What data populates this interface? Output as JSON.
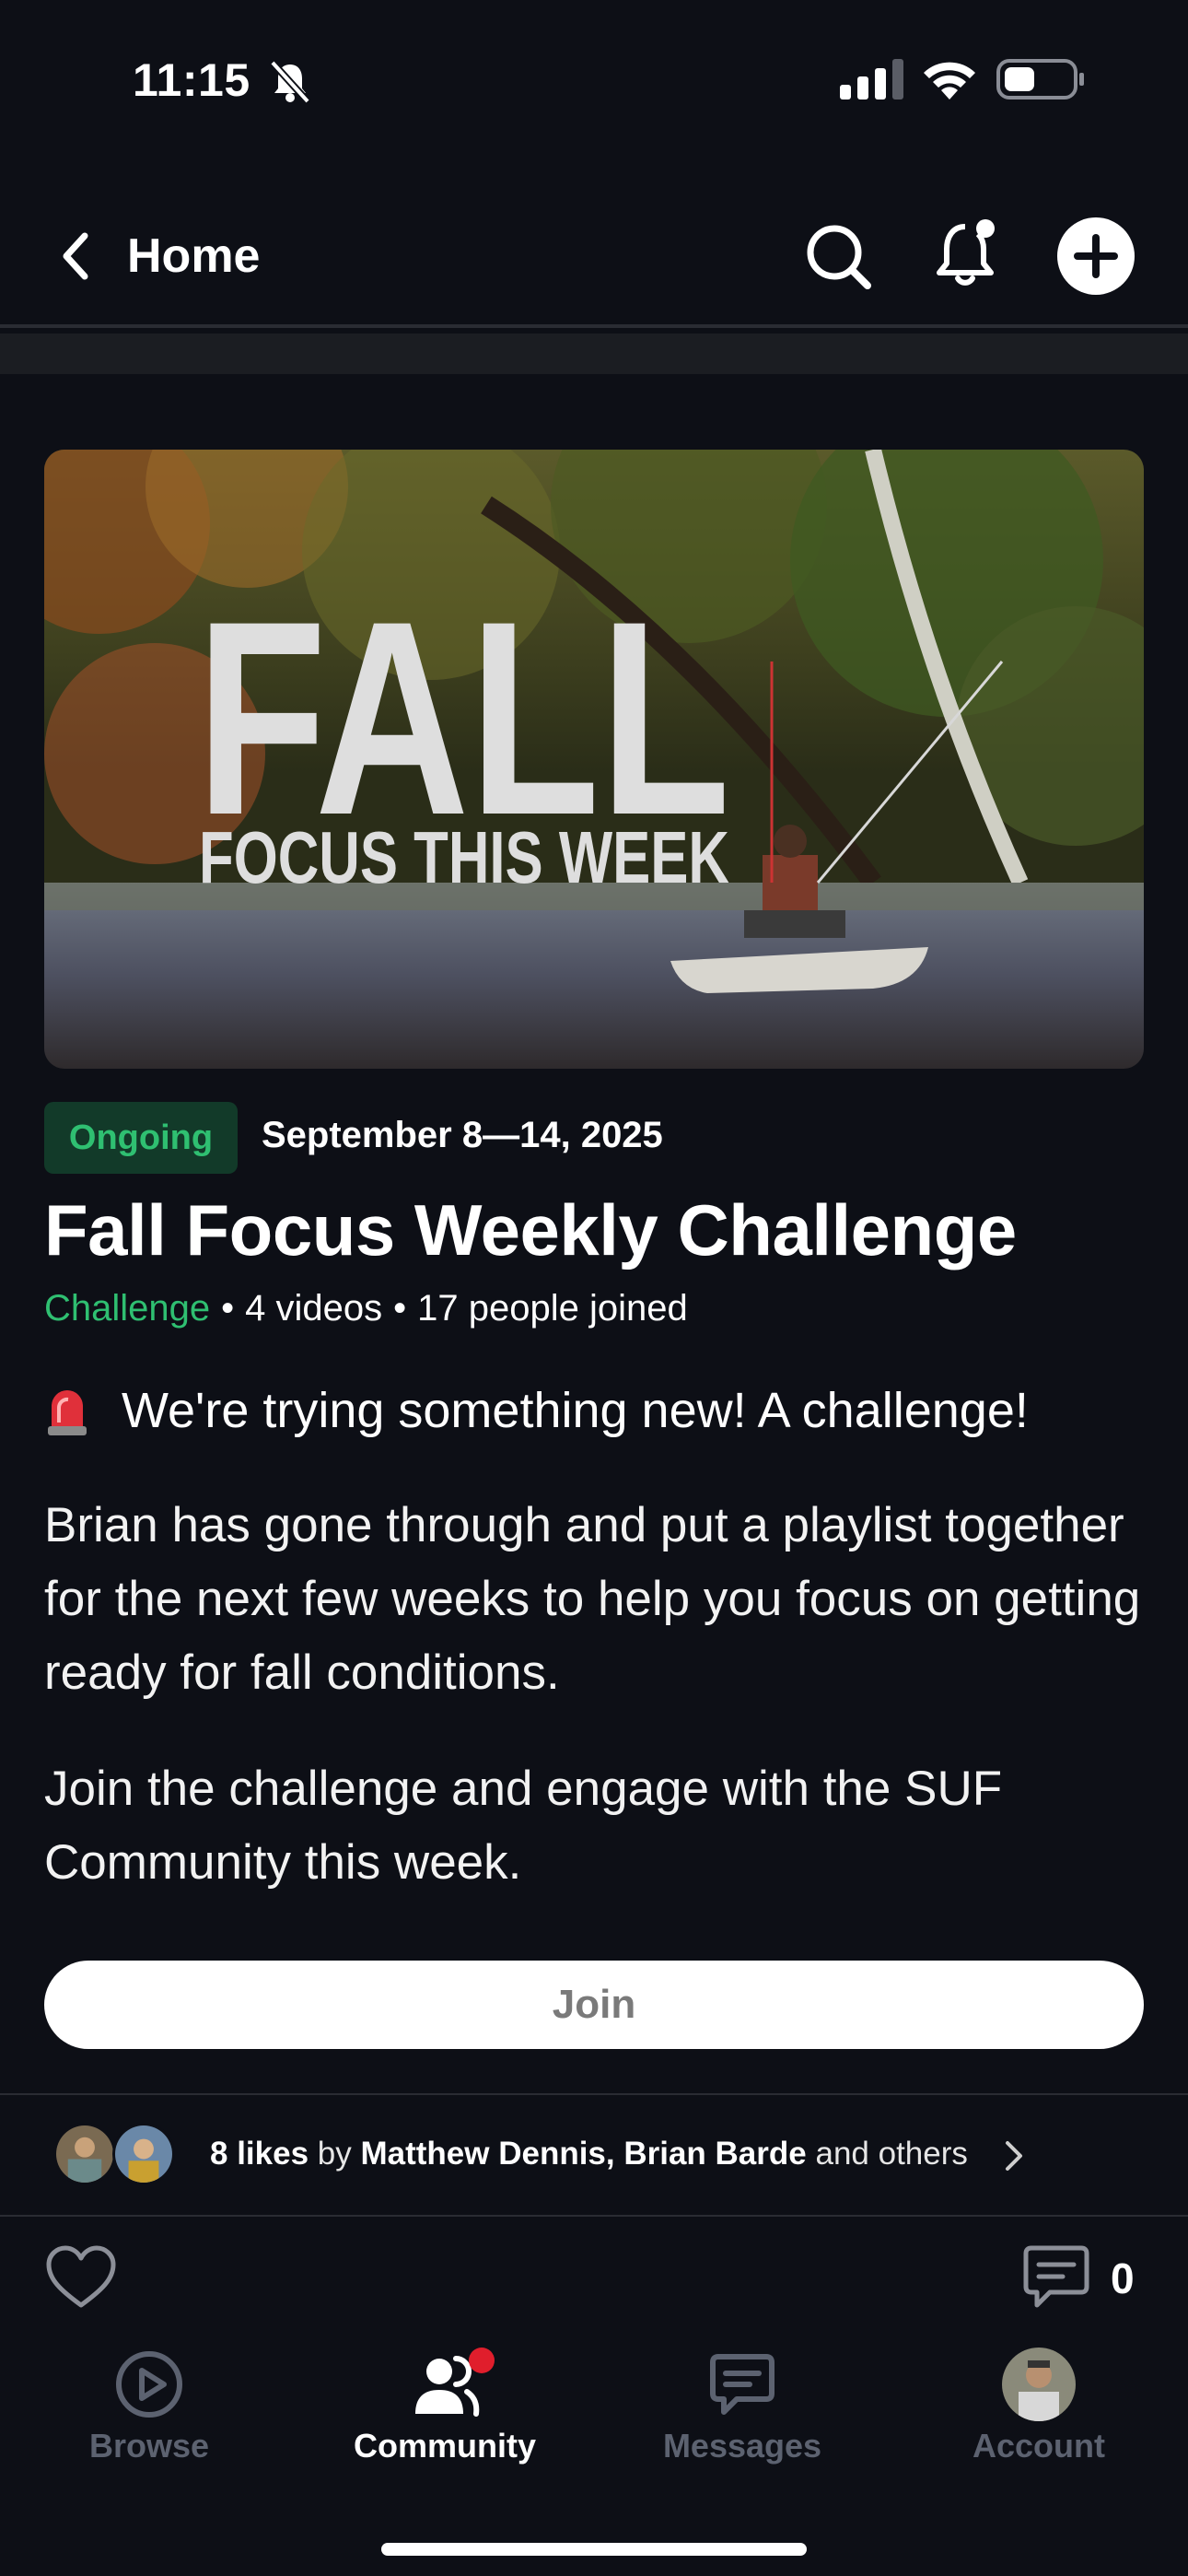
{
  "status_bar": {
    "time": "11:15"
  },
  "nav": {
    "back_label": "Home"
  },
  "hero": {
    "title_big": "FALL",
    "title_small": "FOCUS THIS WEEK"
  },
  "challenge": {
    "status_badge": "Ongoing",
    "dates": "September 8—14, 2025",
    "title": "Fall Focus Weekly Challenge",
    "kind": "Challenge",
    "videos": "4 videos",
    "joined": "17 people joined",
    "notice": "We're trying something new!  A challenge!",
    "paragraph1": "Brian has gone through and put a playlist together for the next few weeks to help you focus on getting ready for fall conditions.",
    "paragraph2": "Join the challenge and engage with the SUF Community this week.",
    "join_label": "Join"
  },
  "likes": {
    "count_text": "8 likes",
    "by": "by",
    "names": "Matthew Dennis, Brian Barde",
    "others": "and others"
  },
  "comments": {
    "count": "0"
  },
  "tabs": [
    {
      "label": "Browse",
      "icon": "play-circle-icon"
    },
    {
      "label": "Community",
      "icon": "people-icon"
    },
    {
      "label": "Messages",
      "icon": "chat-bubble-icon"
    },
    {
      "label": "Account",
      "icon": "avatar"
    }
  ],
  "colors": {
    "accent": "#2fbf71",
    "background": "#0d0f16",
    "badge_bg": "#123a29",
    "notification_dot": "#e01e2c"
  }
}
